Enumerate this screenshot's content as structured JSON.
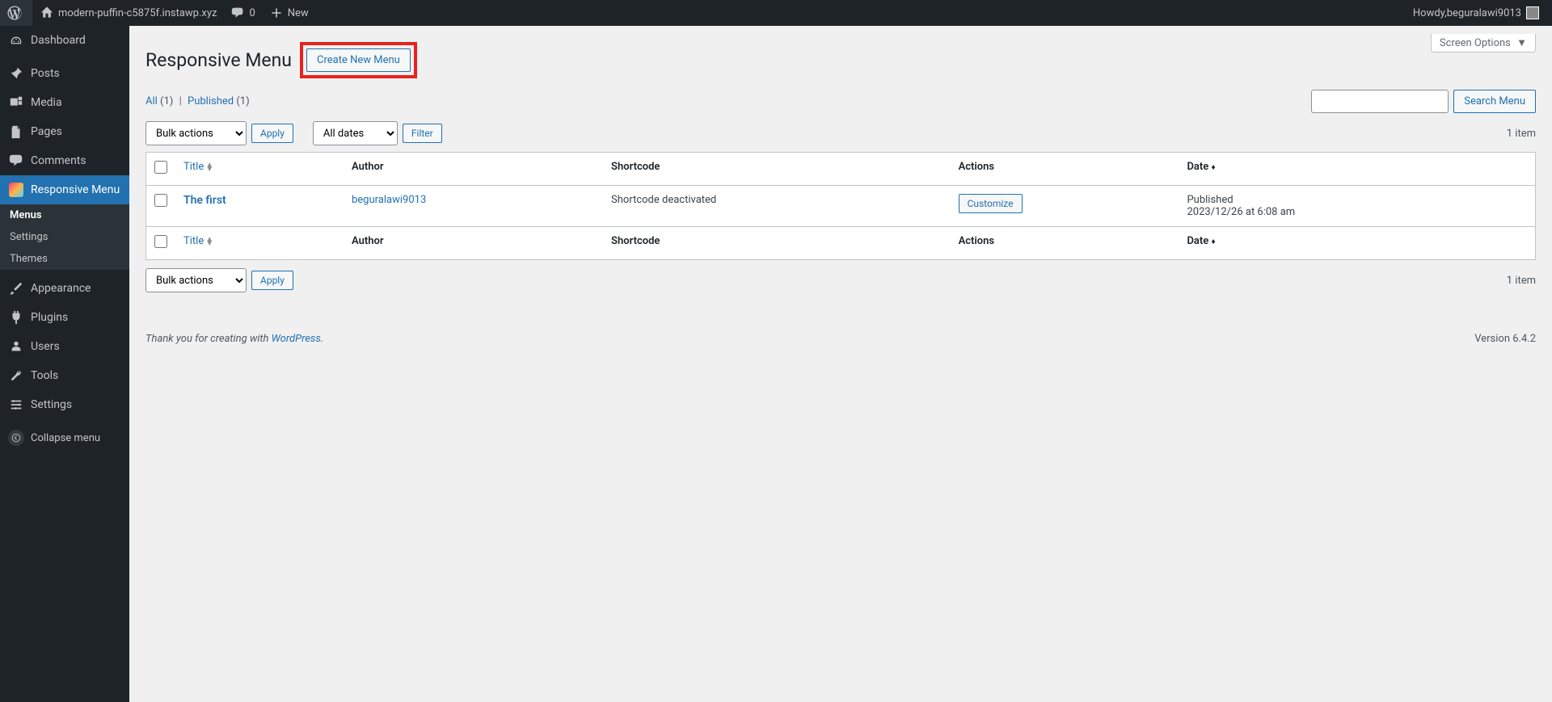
{
  "adminbar": {
    "site_name": "modern-puffin-c5875f.instawp.xyz",
    "comments": "0",
    "new_label": "New",
    "howdy_prefix": "Howdy, ",
    "user": "beguralawi9013"
  },
  "sidebar": {
    "dashboard": "Dashboard",
    "posts": "Posts",
    "media": "Media",
    "pages": "Pages",
    "comments": "Comments",
    "responsive_menu": "Responsive Menu",
    "submenu": {
      "menus": "Menus",
      "settings": "Settings",
      "themes": "Themes"
    },
    "appearance": "Appearance",
    "plugins": "Plugins",
    "users": "Users",
    "tools": "Tools",
    "settings_main": "Settings",
    "collapse": "Collapse menu"
  },
  "page": {
    "title": "Responsive Menu",
    "create_button": "Create New Menu",
    "screen_options": "Screen Options"
  },
  "filters": {
    "all_label": "All",
    "all_count": "(1)",
    "sep": "|",
    "published_label": "Published",
    "published_count": "(1)",
    "search_button": "Search Menu",
    "bulk_actions": "Bulk actions",
    "apply": "Apply",
    "all_dates": "All dates",
    "filter": "Filter",
    "item_count": "1 item"
  },
  "table": {
    "headers": {
      "title": "Title",
      "author": "Author",
      "shortcode": "Shortcode",
      "actions": "Actions",
      "date": "Date"
    },
    "rows": [
      {
        "title": "The first",
        "author": "beguralawi9013",
        "shortcode": "Shortcode deactivated",
        "action_label": "Customize",
        "date_status": "Published",
        "date_value": "2023/12/26 at 6:08 am"
      }
    ]
  },
  "footer": {
    "thanks_prefix": "Thank you for creating with ",
    "wp": "WordPress",
    "period": ".",
    "version": "Version 6.4.2"
  }
}
